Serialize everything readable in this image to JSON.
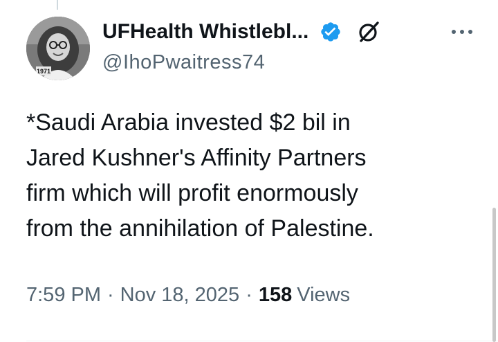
{
  "author": {
    "display_name": "UFHealth Whistlebl...",
    "handle": "@IhoPwaitress74",
    "avatar_caption": "1971",
    "verified": true
  },
  "tweet": {
    "text": "*Saudi Arabia invested $2 bil in\nJared Kushner's Affinity Partners\nfirm which will profit enormously\nfrom the annihilation of Palestine."
  },
  "meta": {
    "time": "7:59 PM",
    "separator": "·",
    "date": "Nov 18, 2025",
    "views_count": "158",
    "views_label": "Views"
  },
  "icons": {
    "verified": "verified-badge-icon",
    "grok": "grok-icon",
    "more": "more-options-icon"
  },
  "colors": {
    "verified_blue": "#1d9bf0",
    "text_primary": "#0f1419",
    "text_secondary": "#536471"
  }
}
